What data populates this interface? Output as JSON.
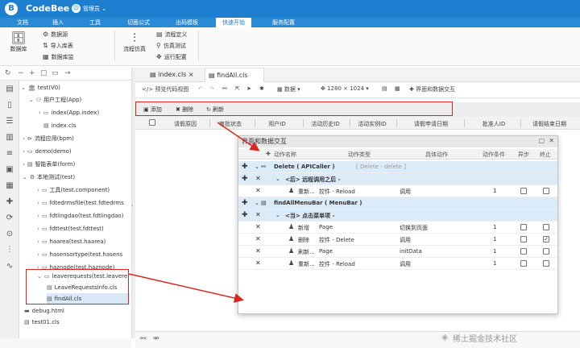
{
  "app": {
    "name": "CodeBee",
    "logo": "B",
    "user": "管理员",
    "user_caret": "⌄"
  },
  "menu_tabs": [
    "文档",
    "插入",
    "工具",
    "切面公式",
    "出码模板",
    "快速开始",
    "服务配置"
  ],
  "ribbon": {
    "db_group_label": "数据库",
    "db_items": [
      "数据源",
      "导入库表",
      "数据库监"
    ],
    "flow_group_label": "流程仿真",
    "flow_items": [
      "流程定义",
      "仿真测试",
      "运行配置"
    ]
  },
  "tree": {
    "root": "test(V0)",
    "nodes": [
      "用户工程(App)",
      "index(App.index)",
      "index.cls",
      "流程应用(bpm)",
      "demo(demo)",
      "智能表单(form)",
      "本地测试(test)",
      "工具(test.component)",
      "fdtedrmsfile(test.fdtedrms",
      "fdtlingdao(test.fdtlingdao)",
      "fdttest(test.fdttest)",
      "haarea(test.haarea)",
      "hasensortype(test.hasens",
      "haznode(test.haznode)",
      "leaverequests(test.leavere",
      "LeaveRequestsInfo.cls",
      "findAll.cls",
      "debug.html",
      "test01.cls"
    ]
  },
  "editor_tabs": [
    "index.cls",
    "findAll.cls"
  ],
  "editor_toolbar": {
    "preview": "预览代码视图",
    "data": "数据",
    "resolution": "1280 × 1024",
    "interaction": "界面和数据交互"
  },
  "toolbar2": {
    "add": "添加",
    "delete": "删除",
    "refresh": "刷新"
  },
  "grid_columns": [
    "请假原因",
    "审批状态",
    "用户ID",
    "活动历史ID",
    "活动实例ID",
    "请假申请日期",
    "批准人ID",
    "请假结束日期"
  ],
  "dialog": {
    "title": "界面和数据交互",
    "columns": [
      "动作名称",
      "动作类型",
      "具体动作",
      "动作条件",
      "异步",
      "终止"
    ],
    "groups": [
      {
        "name": "Delete ( APICaller )",
        "sub": "[ Delete - delete ]",
        "phase": "<后> 远程调用之后 -",
        "rows": [
          {
            "name": "重新...",
            "type": "控件 - Reload",
            "action": "调用",
            "cond": "1",
            "async": false,
            "stop": false
          }
        ]
      },
      {
        "name": "findAllMenuBar ( MenuBar )",
        "sub": "",
        "phase": "<当> 点击菜单项 -",
        "rows": [
          {
            "name": "新增",
            "type": "Page",
            "action": "切换到页面",
            "cond": "1",
            "async": false,
            "stop": false
          },
          {
            "name": "删除",
            "type": "控件 - Delete",
            "action": "调用",
            "cond": "1",
            "async": false,
            "stop": true
          },
          {
            "name": "刷新...",
            "type": "Page",
            "action": "initData",
            "cond": "1",
            "async": false,
            "stop": false
          },
          {
            "name": "重新...",
            "type": "控件 - Reload",
            "action": "调用",
            "cond": "1",
            "async": false,
            "stop": false
          }
        ]
      }
    ]
  },
  "watermark": "稀土掘金技术社区",
  "colors": {
    "brand": "#1e7fd1",
    "highlight": "#d9271f",
    "selected_row": "#dcebf8"
  }
}
